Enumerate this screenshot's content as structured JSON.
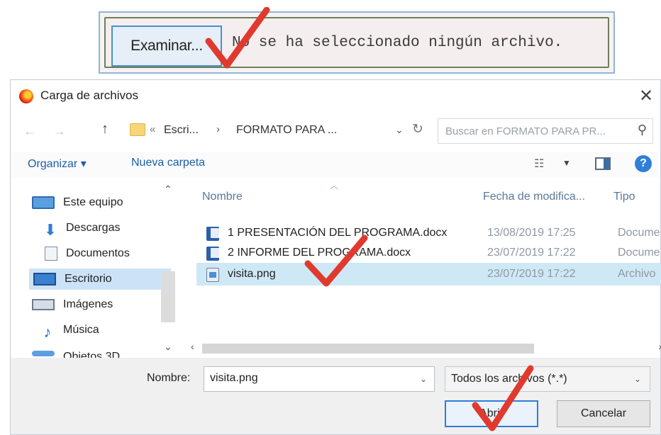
{
  "file_input": {
    "browse_label": "Examinar...",
    "status_text": "No se ha seleccionado ningún archivo."
  },
  "dialog": {
    "title": "Carga de archivos",
    "close_glyph": "✕",
    "address": {
      "separator": "«",
      "crumb1": "Escri...",
      "arrow": "›",
      "crumb2": "FORMATO PARA ...",
      "dropdown_glyph": "⌄",
      "refresh_glyph": "↻"
    },
    "search": {
      "placeholder": "Buscar en FORMATO PARA PR..."
    },
    "toolbar": {
      "organize_label": "Organizar ▾",
      "new_folder_label": "Nueva carpeta",
      "help_glyph": "?"
    },
    "nav_items": [
      {
        "label": "Este equipo",
        "icon": "computer-icon"
      },
      {
        "label": "Descargas",
        "icon": "download-icon"
      },
      {
        "label": "Documentos",
        "icon": "documents-icon"
      },
      {
        "label": "Escritorio",
        "icon": "desktop-icon"
      },
      {
        "label": "Imágenes",
        "icon": "pictures-icon"
      },
      {
        "label": "Música",
        "icon": "music-icon"
      },
      {
        "label": "Objetos 3D",
        "icon": "objects-3d-icon"
      }
    ],
    "columns": {
      "name": "Nombre",
      "date": "Fecha de modifica...",
      "type": "Tipo"
    },
    "files": [
      {
        "name": "1 PRESENTACIÓN DEL PROGRAMA.docx",
        "date": "13/08/2019 17:25",
        "type": "Docume",
        "icon": "word-doc-icon"
      },
      {
        "name": "2 INFORME DEL PROGRAMA.docx",
        "date": "23/07/2019 17:22",
        "type": "Docume",
        "icon": "word-doc-icon"
      },
      {
        "name": "visita.png",
        "date": "23/07/2019 17:22",
        "type": "Archivo",
        "icon": "image-file-icon"
      }
    ],
    "bottom": {
      "name_label": "Nombre:",
      "name_value": "visita.png",
      "file_type_value": "Todos los archivos (*.*)",
      "open_label": "Abrir",
      "cancel_label": "Cancelar"
    }
  },
  "colors": {
    "accent": "#2f7fd8",
    "selection": "#cce3f7",
    "check_mark": "#e03a2f"
  }
}
